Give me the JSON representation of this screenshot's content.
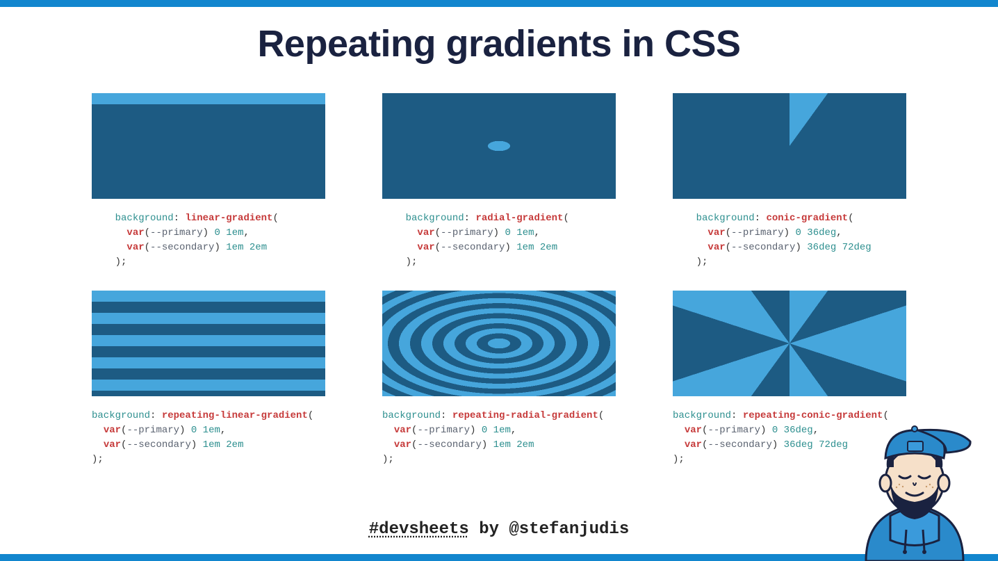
{
  "title": "Repeating gradients in CSS",
  "cells": [
    {
      "preview": "linear",
      "indent": "    ",
      "fn": "linear-gradient",
      "stop1_vals": "0 1em",
      "stop2_vals": "1em 2em"
    },
    {
      "preview": "radial",
      "indent": "    ",
      "fn": "radial-gradient",
      "stop1_vals": "0 1em",
      "stop2_vals": "1em 2em"
    },
    {
      "preview": "conic",
      "indent": "    ",
      "fn": "conic-gradient",
      "stop1_vals": "0 36deg",
      "stop2_vals": "36deg 72deg"
    },
    {
      "preview": "rlinear",
      "indent": "",
      "fn": "repeating-linear-gradient",
      "stop1_vals": "0 1em",
      "stop2_vals": "1em 2em"
    },
    {
      "preview": "rradial",
      "indent": "",
      "fn": "repeating-radial-gradient",
      "stop1_vals": "0 1em",
      "stop2_vals": "1em 2em"
    },
    {
      "preview": "rconic",
      "indent": "",
      "fn": "repeating-conic-gradient",
      "stop1_vals": "0 36deg",
      "stop2_vals": "36deg 72deg"
    }
  ],
  "code_common": {
    "prop": "background",
    "var_kw": "var",
    "var1": "--primary",
    "var2": "--secondary"
  },
  "footer": {
    "hashtag": "#devsheets",
    "by": " by ",
    "handle": "@stefanjudis"
  }
}
